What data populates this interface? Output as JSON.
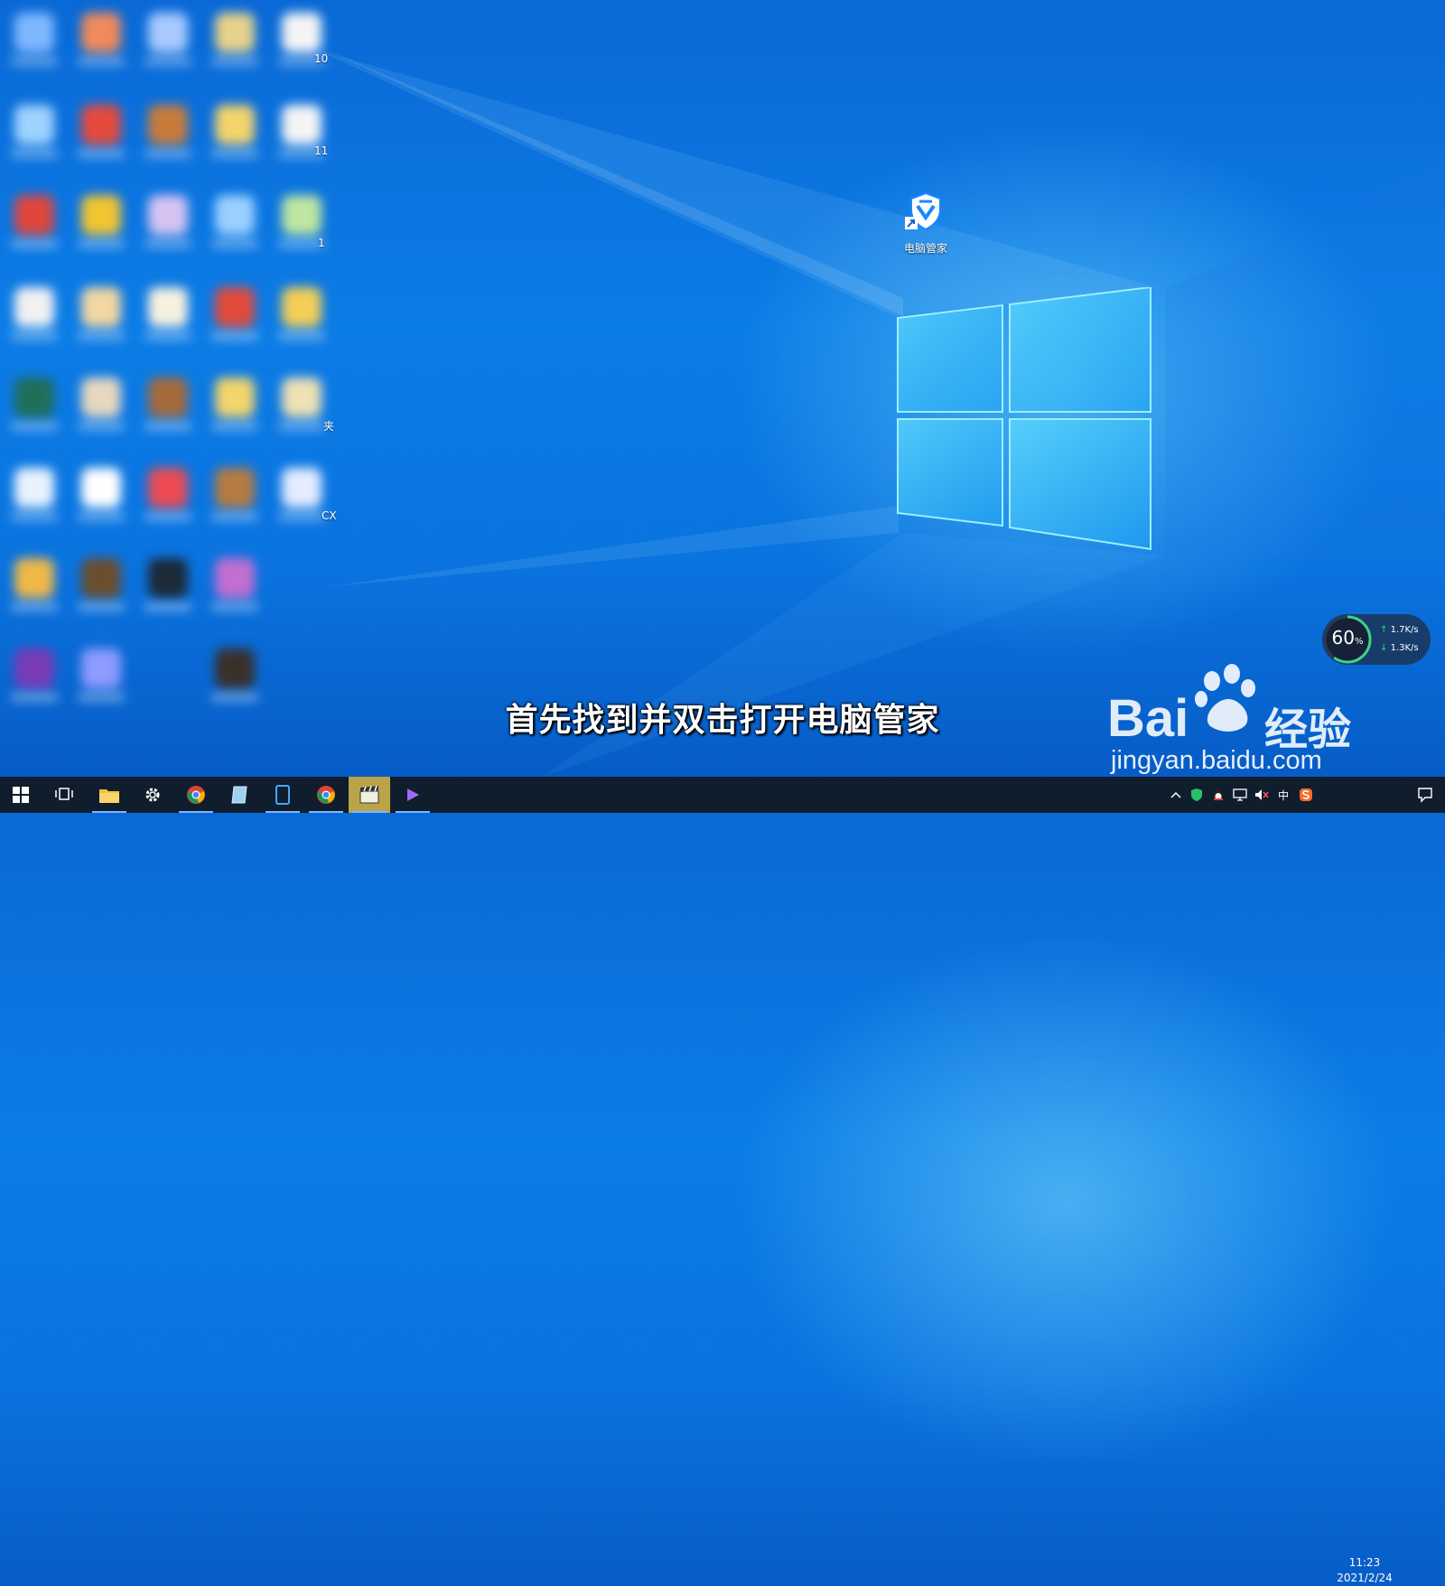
{
  "desktop": {
    "shortcut_label": "电脑管家",
    "edge_labels": [
      "10",
      "11",
      "1",
      "夹",
      "CX"
    ]
  },
  "subtitle": "首先找到并双击打开电脑管家",
  "watermark": {
    "brand": "Bai",
    "brand2": "经验",
    "url": "jingyan.baidu.com"
  },
  "speed_widget": {
    "percent": "60",
    "percent_unit": "%",
    "upload": "1.7",
    "upload_unit": "K/s",
    "download": "1.3",
    "download_unit": "K/s"
  },
  "taskbar": {
    "apps": [
      "start-icon",
      "task-view-icon",
      "file-explorer-icon",
      "settings-icon",
      "chrome-icon",
      "notes-icon",
      "phone-icon",
      "chrome-icon",
      "movie-maker-icon",
      "media-player-icon"
    ],
    "tray": {
      "ime": "中"
    },
    "clock_time": "11:23",
    "clock_date": "2021/2/24"
  },
  "colors": {
    "desktop": "#0a73df",
    "taskbar": "#0f1d2d",
    "accent": "#3ed38b"
  }
}
